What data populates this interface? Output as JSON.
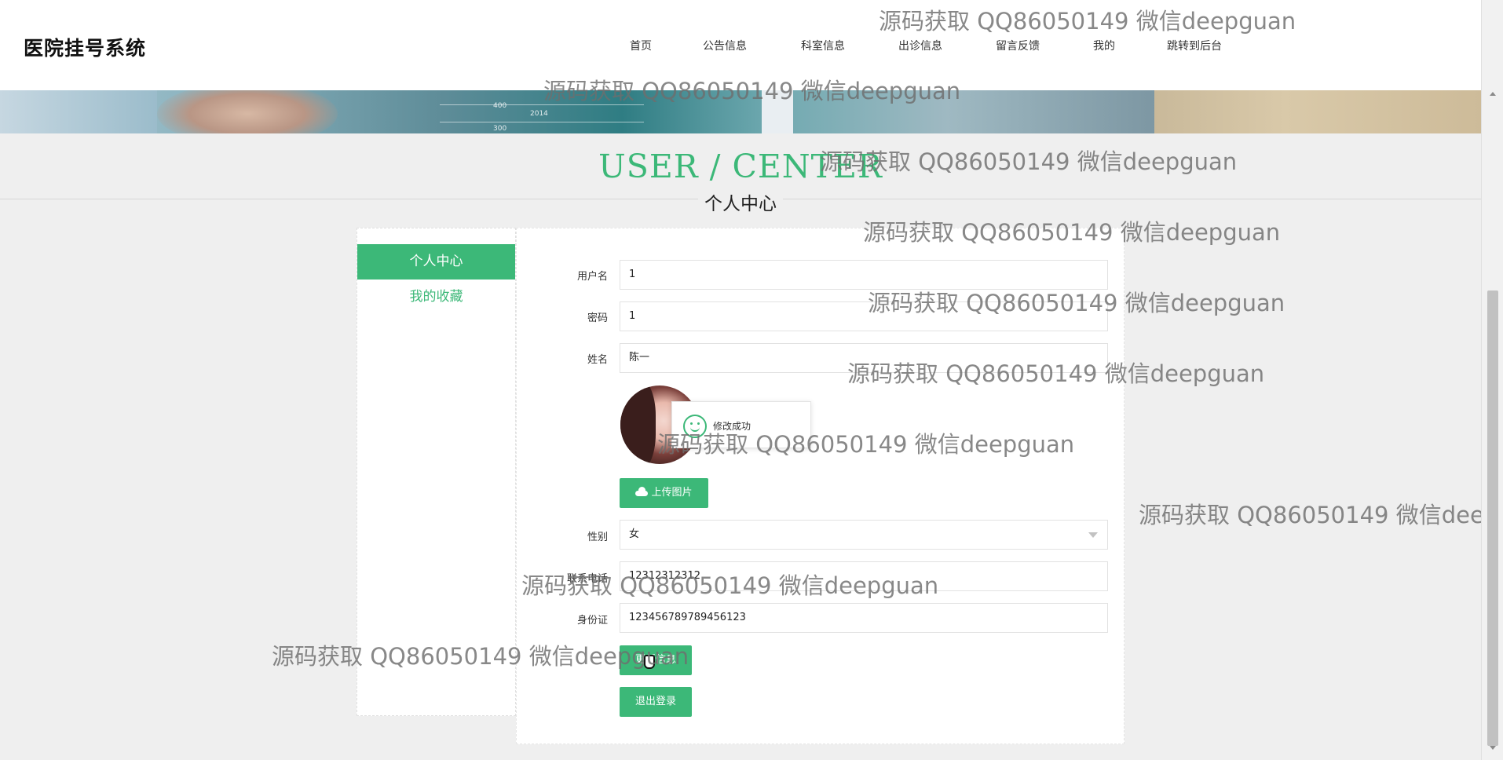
{
  "header": {
    "logo": "医院挂号系统",
    "nav": [
      {
        "label": "首页"
      },
      {
        "label": "公告信息"
      },
      {
        "label": "科室信息"
      },
      {
        "label": "出诊信息"
      },
      {
        "label": "留言反馈"
      },
      {
        "label": "我的"
      },
      {
        "label": "跳转到后台"
      }
    ]
  },
  "banner": {
    "ticks": [
      "400",
      "300",
      "2014"
    ]
  },
  "title": {
    "en": "USER / CENTER",
    "cn": "个人中心"
  },
  "side_menu": {
    "items": [
      {
        "label": "个人中心",
        "active": true
      },
      {
        "label": "我的收藏",
        "active": false
      }
    ]
  },
  "form": {
    "username": {
      "label": "用户名",
      "value": "1"
    },
    "password": {
      "label": "密码",
      "value": "1"
    },
    "name": {
      "label": "姓名",
      "value": "陈一"
    },
    "upload_label": "上传图片",
    "gender": {
      "label": "性别",
      "value": "女"
    },
    "phone": {
      "label": "联系电话",
      "value": "12312312312"
    },
    "id_card": {
      "label": "身份证",
      "value": "123456789789456123"
    },
    "update_label": "更新信息",
    "logout_label": "退出登录"
  },
  "toast": {
    "message": "修改成功"
  },
  "watermark": "源码获取 QQ86050149 微信deepguan",
  "colors": {
    "accent": "#3cb878",
    "page_bg": "#efefef"
  }
}
